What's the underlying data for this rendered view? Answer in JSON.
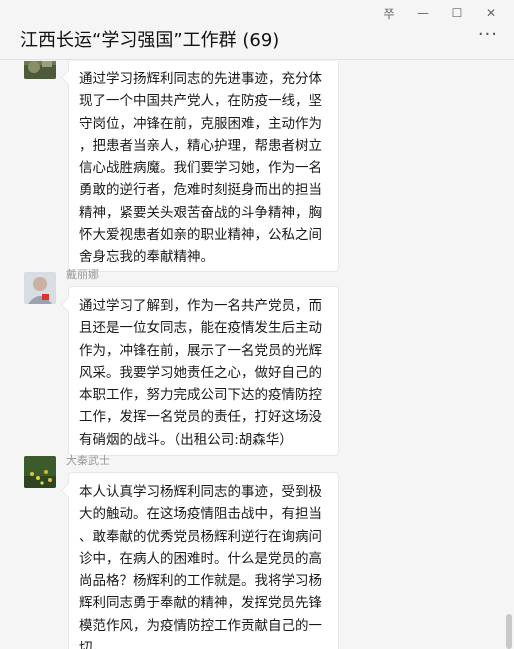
{
  "window": {
    "title": "江西长运“学习强国”工作群 (69)",
    "pin_label": "쭈",
    "minimize_label": "—",
    "maximize_label": "☐",
    "close_label": "✕",
    "more_label": "···"
  },
  "messages": [
    {
      "sender": "",
      "avatar": "landscape-avatar",
      "text": "通过学习扬辉利同志的先进事迹，充分体\n现了一个中国共产党人，在防疫一线，坚\n守岗位，冲锋在前，克服困难，主动作为\n，把患者当亲人，精心护理，帮患者树立\n信心战胜病魔。我们要学习她，作为一名\n勇敢的逆行者，危难时刻挺身而出的担当\n精神，紧要关头艰苦奋战的斗争精神，胸\n怀大爱视患者如亲的职业精神，公私之间\n舍身忘我的奉献精神。"
    },
    {
      "sender": "戴丽娜",
      "avatar": "portrait-avatar",
      "text": "通过学习了解到，作为一名共产党员，而\n且还是一位女同志，能在疫情发生后主动\n作为，冲锋在前，展示了一名党员的光辉\n风采。我要学习她责任之心，做好自己的\n本职工作，努力完成公司下达的疫情防控\n工作，发挥一名党员的责任，打好这场没\n有硝烟的战斗。（出租公司:胡森华）"
    },
    {
      "sender": "大秦武士",
      "avatar": "flowers-avatar",
      "text": "本人认真学习杨辉利同志的事迹，受到极\n大的触动。在这场疫情阻击战中，有担当\n、敢奉献的优秀党员杨辉利逆行在询病问\n诊中，在病人的困难时。什么是党员的高\n尚品格？杨辉利的工作就是。我将学习杨\n辉利同志勇于奉献的精神，发挥党员先锋\n模范作风，为疫情防控工作贡献自己的一\n切。"
    }
  ]
}
